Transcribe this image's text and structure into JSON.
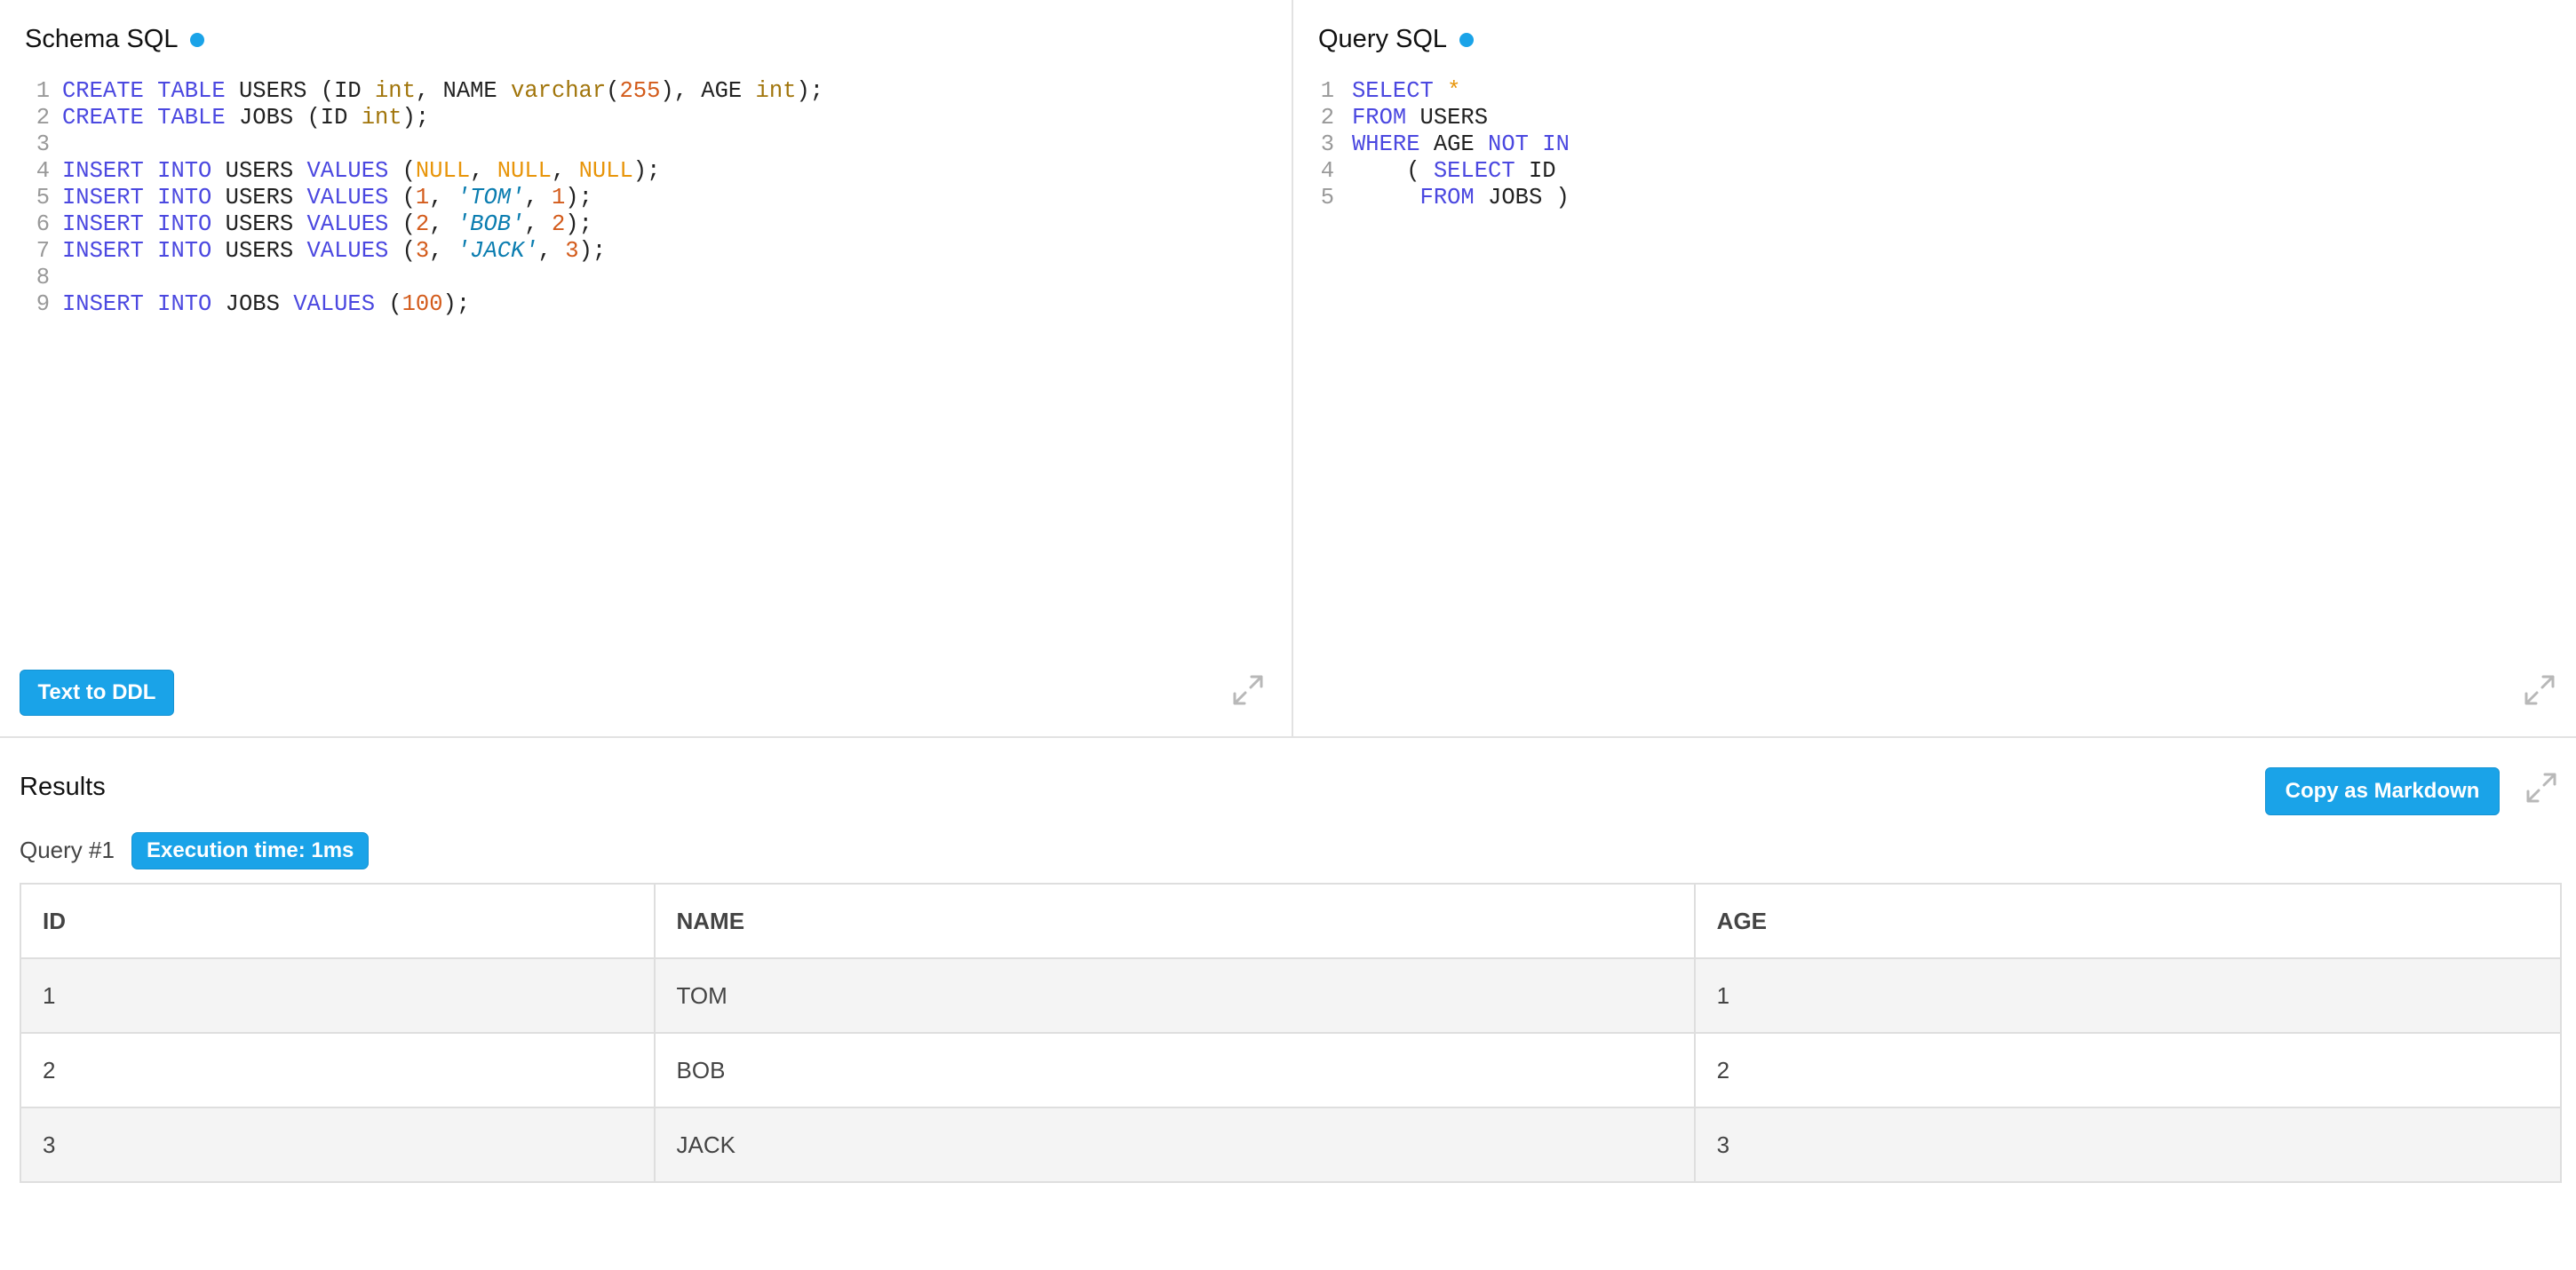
{
  "schema_pane": {
    "title": "Schema SQL",
    "lines": [
      {
        "n": "1",
        "tokens": [
          [
            "kw",
            "CREATE"
          ],
          [
            "tx",
            " "
          ],
          [
            "kw",
            "TABLE"
          ],
          [
            "tx",
            " USERS (ID "
          ],
          [
            "ty",
            "int"
          ],
          [
            "tx",
            ", NAME "
          ],
          [
            "ty",
            "varchar"
          ],
          [
            "tx",
            "("
          ],
          [
            "nu",
            "255"
          ],
          [
            "tx",
            "), AGE "
          ],
          [
            "ty",
            "int"
          ],
          [
            "tx",
            ");"
          ]
        ]
      },
      {
        "n": "2",
        "tokens": [
          [
            "kw",
            "CREATE"
          ],
          [
            "tx",
            " "
          ],
          [
            "kw",
            "TABLE"
          ],
          [
            "tx",
            " JOBS (ID "
          ],
          [
            "ty",
            "int"
          ],
          [
            "tx",
            ");"
          ]
        ]
      },
      {
        "n": "3",
        "tokens": []
      },
      {
        "n": "4",
        "tokens": [
          [
            "kw",
            "INSERT"
          ],
          [
            "tx",
            " "
          ],
          [
            "kw",
            "INTO"
          ],
          [
            "tx",
            " USERS "
          ],
          [
            "kw",
            "VALUES"
          ],
          [
            "tx",
            " ("
          ],
          [
            "nl",
            "NULL"
          ],
          [
            "tx",
            ", "
          ],
          [
            "nl",
            "NULL"
          ],
          [
            "tx",
            ", "
          ],
          [
            "nl",
            "NULL"
          ],
          [
            "tx",
            ");"
          ]
        ]
      },
      {
        "n": "5",
        "tokens": [
          [
            "kw",
            "INSERT"
          ],
          [
            "tx",
            " "
          ],
          [
            "kw",
            "INTO"
          ],
          [
            "tx",
            " USERS "
          ],
          [
            "kw",
            "VALUES"
          ],
          [
            "tx",
            " ("
          ],
          [
            "nu",
            "1"
          ],
          [
            "tx",
            ", "
          ],
          [
            "st",
            "'TOM'"
          ],
          [
            "tx",
            ", "
          ],
          [
            "nu",
            "1"
          ],
          [
            "tx",
            ");"
          ]
        ]
      },
      {
        "n": "6",
        "tokens": [
          [
            "kw",
            "INSERT"
          ],
          [
            "tx",
            " "
          ],
          [
            "kw",
            "INTO"
          ],
          [
            "tx",
            " USERS "
          ],
          [
            "kw",
            "VALUES"
          ],
          [
            "tx",
            " ("
          ],
          [
            "nu",
            "2"
          ],
          [
            "tx",
            ", "
          ],
          [
            "st",
            "'BOB'"
          ],
          [
            "tx",
            ", "
          ],
          [
            "nu",
            "2"
          ],
          [
            "tx",
            ");"
          ]
        ]
      },
      {
        "n": "7",
        "tokens": [
          [
            "kw",
            "INSERT"
          ],
          [
            "tx",
            " "
          ],
          [
            "kw",
            "INTO"
          ],
          [
            "tx",
            " USERS "
          ],
          [
            "kw",
            "VALUES"
          ],
          [
            "tx",
            " ("
          ],
          [
            "nu",
            "3"
          ],
          [
            "tx",
            ", "
          ],
          [
            "st",
            "'JACK'"
          ],
          [
            "tx",
            ", "
          ],
          [
            "nu",
            "3"
          ],
          [
            "tx",
            ");"
          ]
        ]
      },
      {
        "n": "8",
        "tokens": []
      },
      {
        "n": "9",
        "tokens": [
          [
            "kw",
            "INSERT"
          ],
          [
            "tx",
            " "
          ],
          [
            "kw",
            "INTO"
          ],
          [
            "tx",
            " JOBS "
          ],
          [
            "kw",
            "VALUES"
          ],
          [
            "tx",
            " ("
          ],
          [
            "nu",
            "100"
          ],
          [
            "tx",
            ");"
          ]
        ]
      }
    ],
    "button_label": "Text to DDL",
    "expand_icon": "expand-icon"
  },
  "query_pane": {
    "title": "Query SQL",
    "lines": [
      {
        "n": "1",
        "tokens": [
          [
            "kw",
            "SELECT"
          ],
          [
            "tx",
            " "
          ],
          [
            "nl",
            "*"
          ]
        ]
      },
      {
        "n": "2",
        "tokens": [
          [
            "kw",
            "FROM"
          ],
          [
            "tx",
            " USERS"
          ]
        ]
      },
      {
        "n": "3",
        "tokens": [
          [
            "kw",
            "WHERE"
          ],
          [
            "tx",
            " AGE "
          ],
          [
            "kw",
            "NOT"
          ],
          [
            "tx",
            " "
          ],
          [
            "kw",
            "IN"
          ]
        ]
      },
      {
        "n": "4",
        "tokens": [
          [
            "tx",
            "    ( "
          ],
          [
            "kw",
            "SELECT"
          ],
          [
            "tx",
            " ID"
          ]
        ]
      },
      {
        "n": "5",
        "tokens": [
          [
            "tx",
            "     "
          ],
          [
            "kw",
            "FROM"
          ],
          [
            "tx",
            " JOBS )"
          ]
        ]
      }
    ],
    "expand_icon": "expand-icon"
  },
  "results": {
    "title": "Results",
    "copy_button_label": "Copy as Markdown",
    "query_label": "Query #1",
    "execution_badge": "Execution time: 1ms",
    "columns": [
      "ID",
      "NAME",
      "AGE"
    ],
    "rows": [
      [
        "1",
        "TOM",
        "1"
      ],
      [
        "2",
        "BOB",
        "2"
      ],
      [
        "3",
        "JACK",
        "3"
      ]
    ]
  },
  "colors": {
    "accent": "#1aa3e8",
    "keyword": "#4b48e0",
    "type": "#a1750b",
    "number": "#d35b1b",
    "null": "#e8950a",
    "string": "#0b7db0"
  }
}
